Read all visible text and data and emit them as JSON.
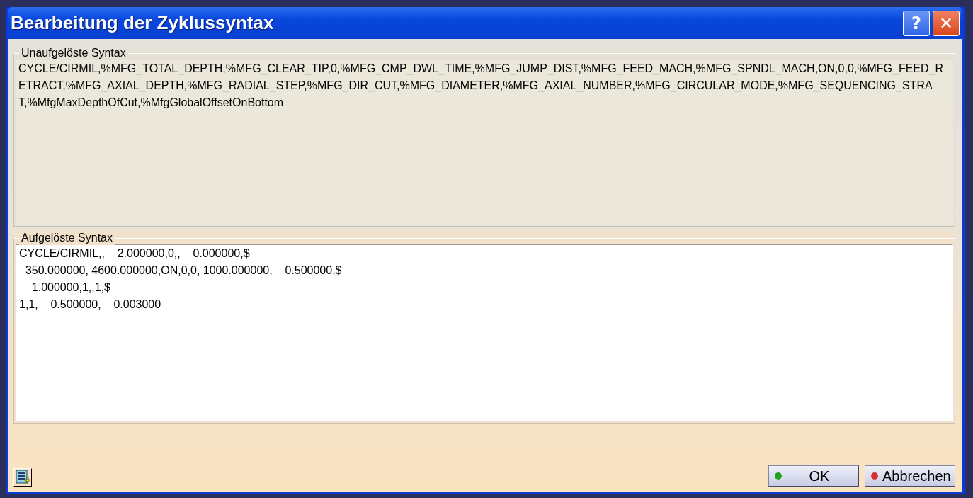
{
  "window": {
    "title": "Bearbeitung der Zyklussyntax"
  },
  "title_buttons": [
    {
      "kind": "help",
      "label": "?"
    },
    {
      "kind": "close",
      "label": "✕"
    }
  ],
  "unresolved": {
    "label": "Unaufgelöste Syntax",
    "text": "CYCLE/CIRMIL,%MFG_TOTAL_DEPTH,%MFG_CLEAR_TIP,0,%MFG_CMP_DWL_TIME,%MFG_JUMP_DIST,%MFG_FEED_MACH,%MFG_SPNDL_MACH,ON,0,0,%MFG_FEED_RETRACT,%MFG_AXIAL_DEPTH,%MFG_RADIAL_STEP,%MFG_DIR_CUT,%MFG_DIAMETER,%MFG_AXIAL_NUMBER,%MFG_CIRCULAR_MODE,%MFG_SEQUENCING_STRAT,%MfgMaxDepthOfCut,%MfgGlobalOffsetOnBottom"
  },
  "resolved": {
    "label": "Aufgelöste Syntax",
    "lines": [
      "CYCLE/CIRMIL,,    2.000000,0,,    0.000000,$",
      "  350.000000, 4600.000000,ON,0,0, 1000.000000,    0.500000,$",
      "    1.000000,1,,1,$",
      "1,1,    0.500000,    0.003000"
    ]
  },
  "buttons": [
    {
      "label": "OK",
      "color": "#22a022"
    },
    {
      "label": "Abbrechen",
      "color": "#d83030"
    }
  ]
}
